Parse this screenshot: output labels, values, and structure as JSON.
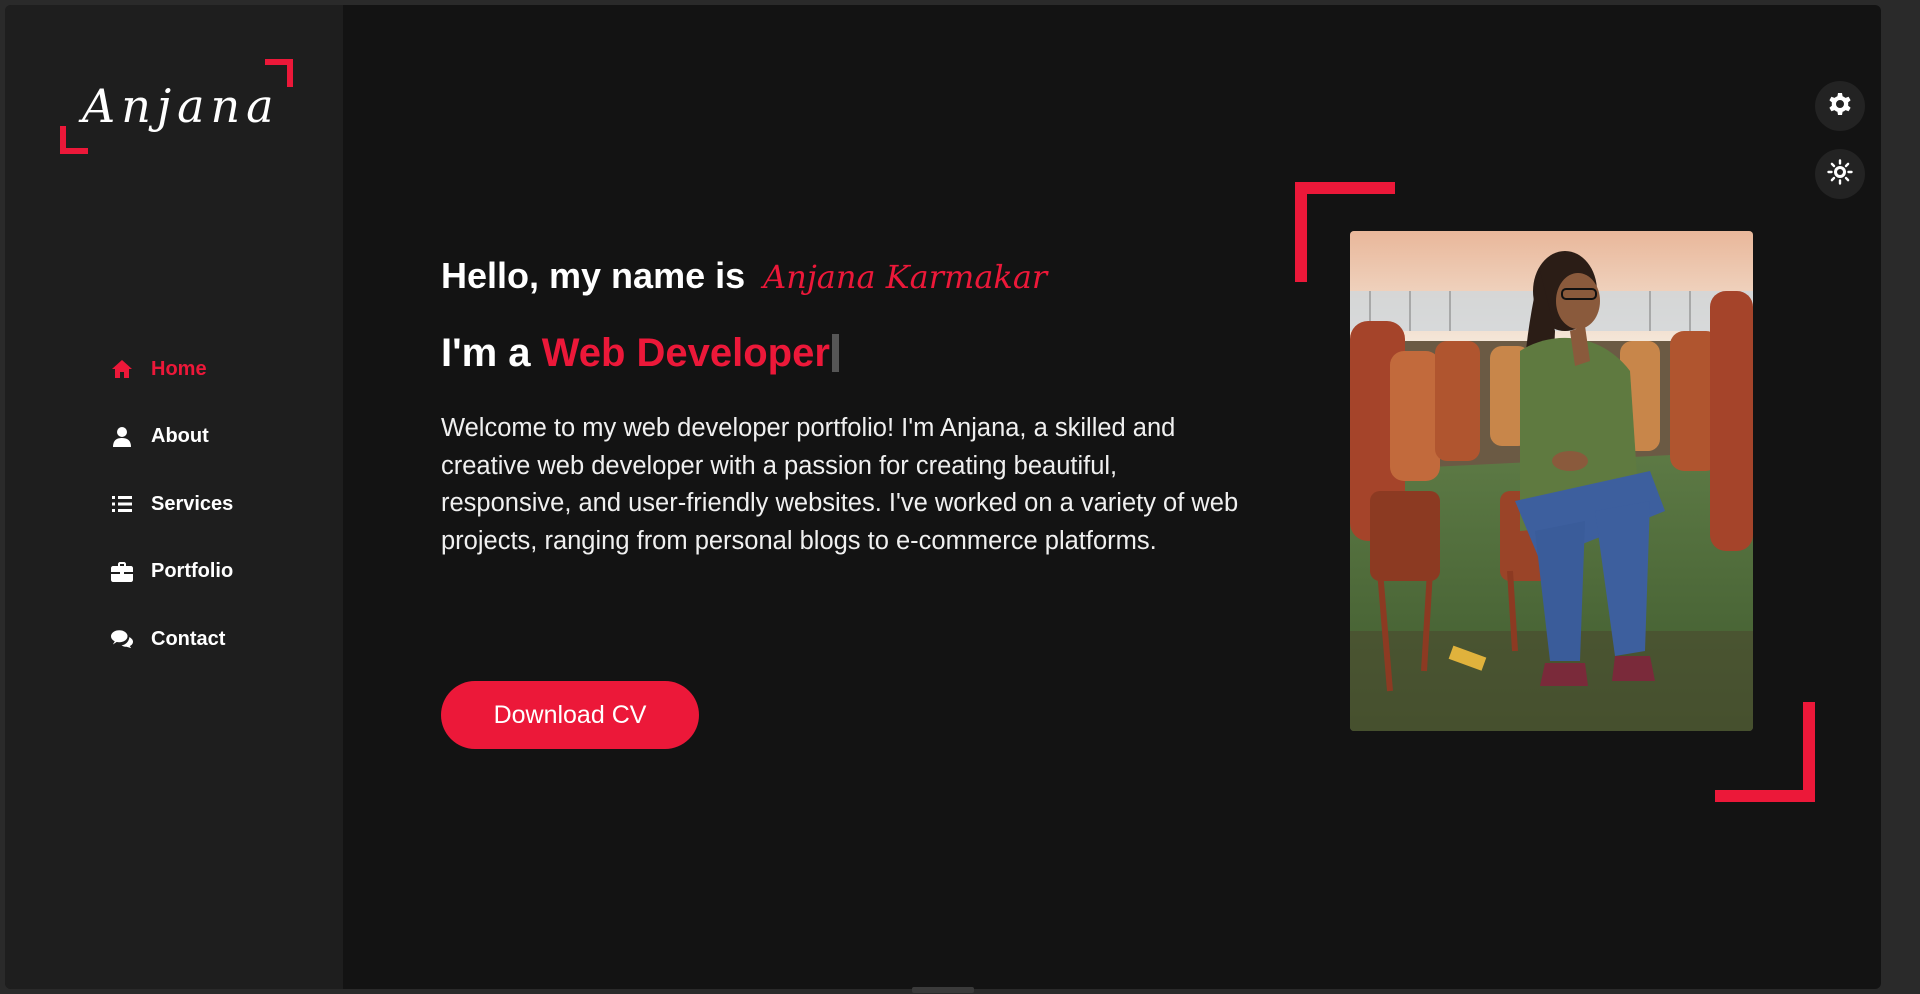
{
  "brand": {
    "logo_text": "Anjana",
    "accent_color": "#ec1839",
    "bg_color": "#131313",
    "sidebar_color": "#1e1e1e"
  },
  "nav": {
    "items": [
      {
        "label": "Home",
        "icon": "home-icon",
        "active": true
      },
      {
        "label": "About",
        "icon": "user-icon",
        "active": false
      },
      {
        "label": "Services",
        "icon": "list-icon",
        "active": false
      },
      {
        "label": "Portfolio",
        "icon": "briefcase-icon",
        "active": false
      },
      {
        "label": "Contact",
        "icon": "comments-icon",
        "active": false
      }
    ]
  },
  "hero": {
    "greeting": "Hello, my name is",
    "name": "Anjana Karmakar",
    "role_prefix": "I'm a",
    "role": "Web Developer",
    "intro": "Welcome to my web developer portfolio! I'm Anjana, a skilled and creative web developer with a passion for creating beautiful, responsive, and user-friendly websites. I've worked on a variety of web projects, ranging from personal blogs to e-commerce platforms.",
    "cta_label": "Download CV",
    "photo_alt": "profile-photo"
  },
  "toolbar": {
    "settings_icon": "gear-icon",
    "theme_icon": "sun-icon"
  }
}
